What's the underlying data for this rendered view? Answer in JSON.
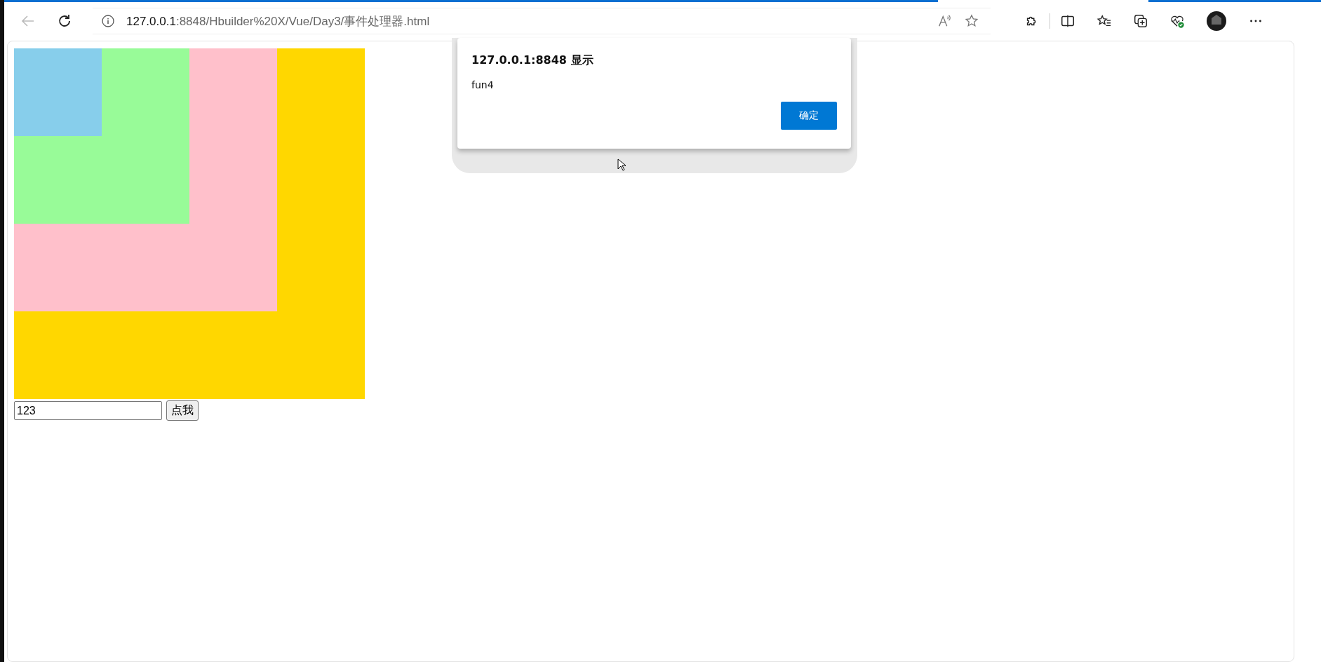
{
  "address_bar": {
    "host": "127.0.0.1",
    "path": ":8848/Hbuilder%20X/Vue/Day3/事件处理器.html"
  },
  "boxes": [
    {
      "color": "#ffd700"
    },
    {
      "color": "#ffc0cb"
    },
    {
      "color": "#98fb98"
    },
    {
      "color": "#87ceeb"
    }
  ],
  "text_input": {
    "value": "123"
  },
  "button": {
    "label": "点我"
  },
  "alert": {
    "title": "127.0.0.1:8848 显示",
    "message": "fun4",
    "ok_button": "确定"
  }
}
